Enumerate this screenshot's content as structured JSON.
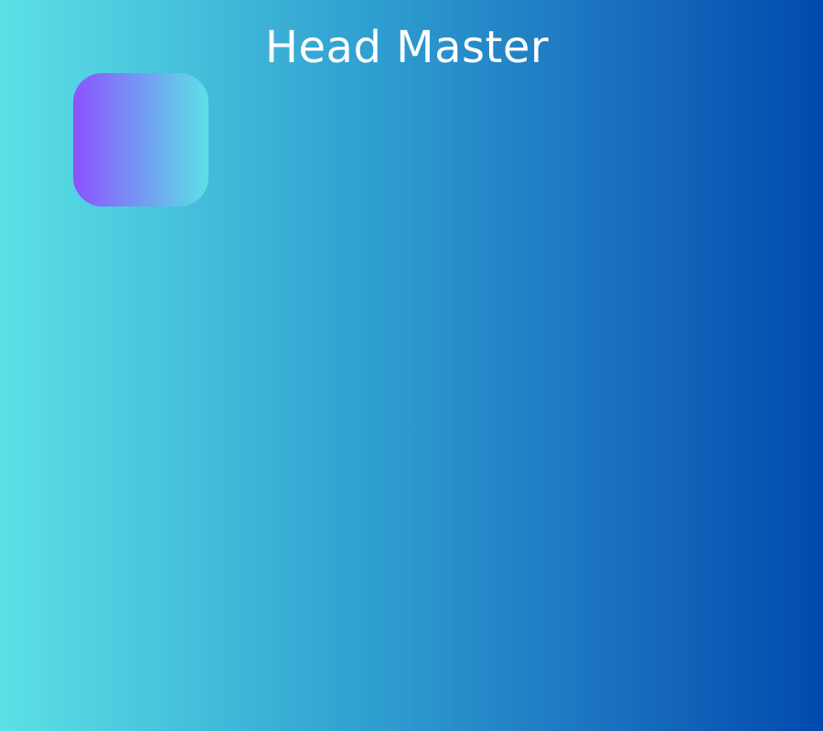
{
  "header": {
    "title": "Head Master"
  },
  "colors": {
    "background_start": "#5ce1e6",
    "background_end": "#004aad",
    "tile_start": "#8c52ff",
    "tile_end": "#5ce1e6",
    "title_text": "#ffffff"
  }
}
